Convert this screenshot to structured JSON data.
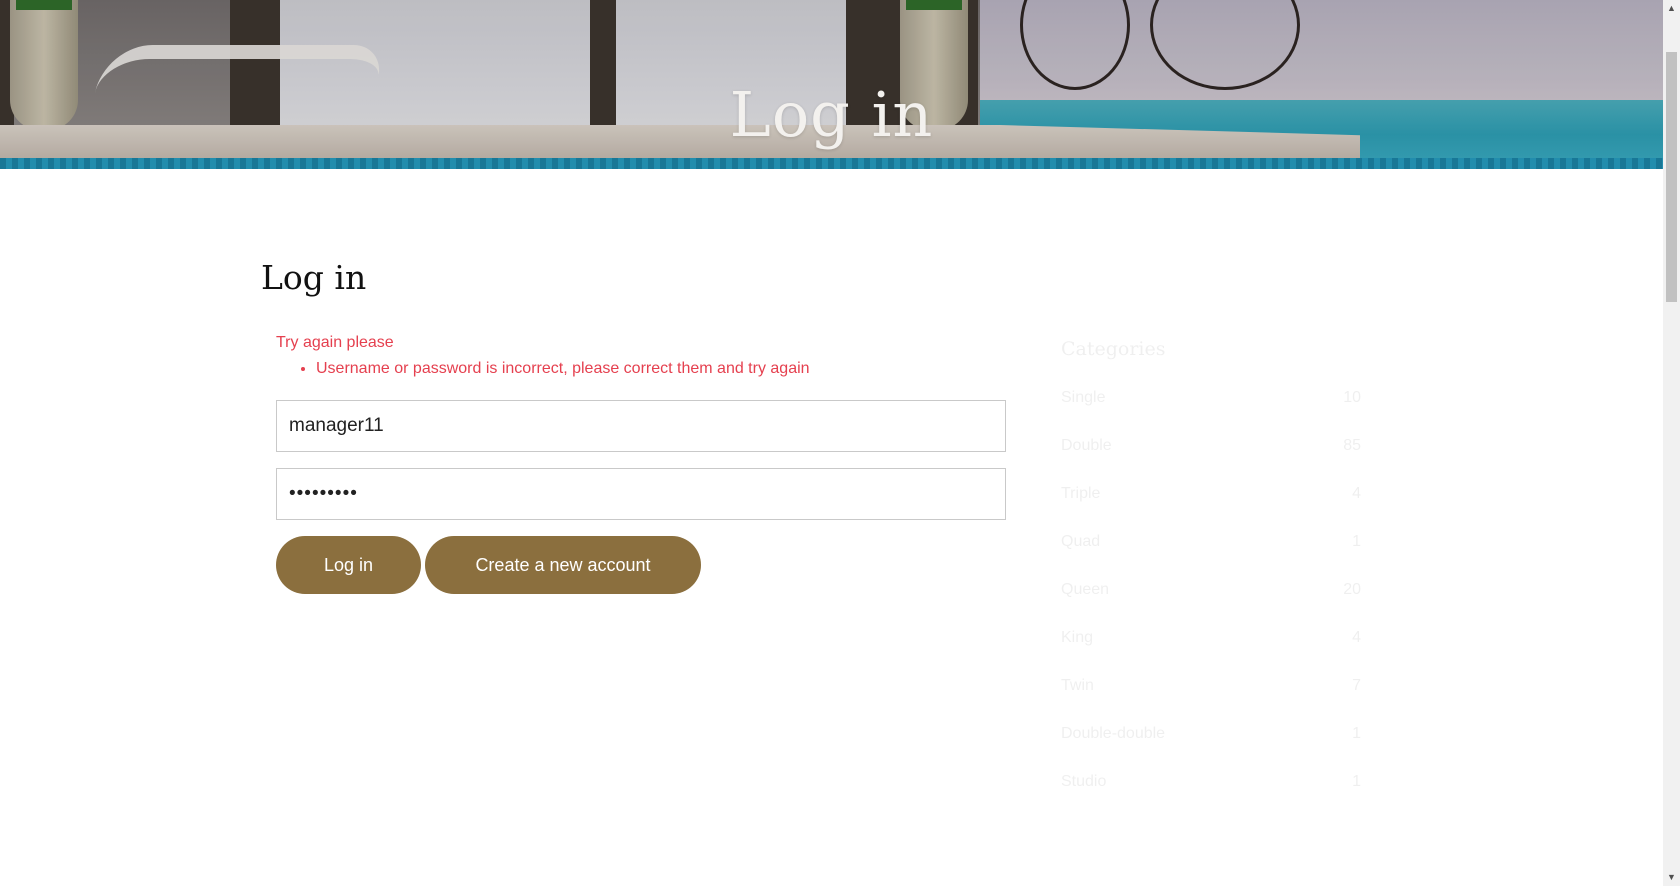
{
  "hero": {
    "title": "Log in"
  },
  "main": {
    "heading": "Log in",
    "error": {
      "title": "Try again please",
      "messages": [
        "Username or password is incorrect, please correct them and try again"
      ]
    },
    "username": {
      "value": "manager11"
    },
    "password": {
      "value": "•••••••••"
    },
    "buttons": {
      "login": "Log in",
      "create": "Create a new account"
    }
  },
  "sidebar": {
    "title": "Categories",
    "items": [
      {
        "label": "Single",
        "count": "10"
      },
      {
        "label": "Double",
        "count": "85"
      },
      {
        "label": "Triple",
        "count": "4"
      },
      {
        "label": "Quad",
        "count": "1"
      },
      {
        "label": "Queen",
        "count": "20"
      },
      {
        "label": "King",
        "count": "4"
      },
      {
        "label": "Twin",
        "count": "7"
      },
      {
        "label": "Double-double",
        "count": "1"
      },
      {
        "label": "Studio",
        "count": "1"
      }
    ]
  },
  "colors": {
    "accent": "#8b6f3e",
    "error": "#e5404f"
  }
}
